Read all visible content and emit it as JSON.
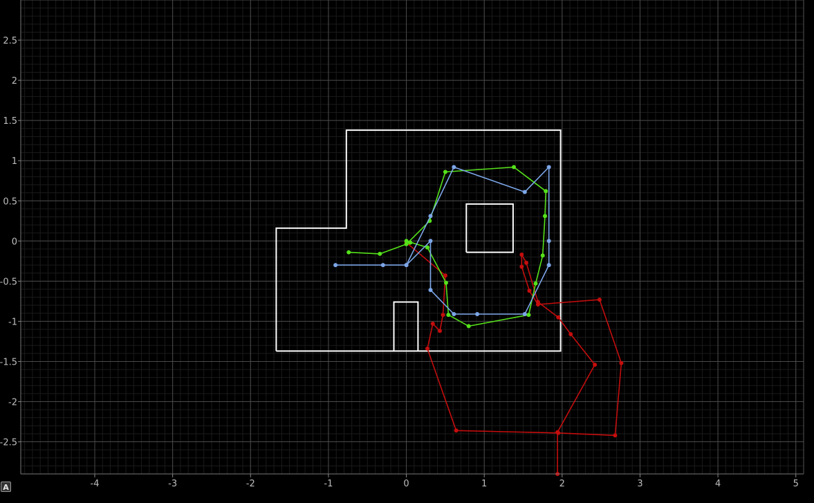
{
  "ui": {
    "autoscale_label": "A"
  },
  "chart_data": {
    "type": "line",
    "xlim": [
      -4.95,
      5.1
    ],
    "ylim": [
      -2.9,
      3.0
    ],
    "x_ticks": [
      -4,
      -3,
      -2,
      -1,
      0,
      1,
      2,
      3,
      4,
      5
    ],
    "y_ticks": [
      -2.5,
      -2,
      -1.5,
      -1,
      -0.5,
      0,
      0.5,
      1,
      1.5,
      2,
      2.5
    ],
    "grid": true,
    "minor_grid_step": 0.1,
    "colors": {
      "background": "#000000",
      "major_grid": "#4a4a4a",
      "minor_grid": "#1b1b1b",
      "walls": "#ffffff",
      "red": "#c40d0d",
      "green": "#55e21a",
      "blue": "#7ca6e8",
      "tick_text": "#bdbdbd"
    },
    "shapes": [
      {
        "points": [
          [
            -1.67,
            -1.37
          ],
          [
            1.98,
            -1.37
          ],
          [
            1.98,
            1.38
          ],
          [
            -0.77,
            1.38
          ],
          [
            -0.77,
            0.16
          ],
          [
            -1.67,
            0.16
          ],
          [
            -1.67,
            -1.37
          ]
        ]
      },
      {
        "points": [
          [
            0.77,
            -0.14
          ],
          [
            1.37,
            -0.14
          ],
          [
            1.37,
            0.46
          ],
          [
            0.77,
            0.46
          ],
          [
            0.77,
            -0.14
          ]
        ]
      },
      {
        "points": [
          [
            -0.16,
            -1.37
          ],
          [
            -0.16,
            -0.76
          ],
          [
            0.15,
            -0.76
          ],
          [
            0.15,
            -1.37
          ]
        ]
      }
    ],
    "series": [
      {
        "color": "red",
        "points": [
          [
            0.0,
            -0.02
          ],
          [
            0.5,
            -0.43
          ],
          [
            0.47,
            -0.92
          ],
          [
            0.43,
            -1.12
          ],
          [
            0.34,
            -1.03
          ],
          [
            0.27,
            -1.34
          ],
          [
            0.64,
            -2.36
          ],
          [
            1.95,
            -2.39
          ],
          [
            2.68,
            -2.42
          ],
          [
            2.76,
            -1.52
          ],
          [
            2.48,
            -0.73
          ],
          [
            1.69,
            -0.79
          ],
          [
            1.58,
            -0.62
          ],
          [
            1.48,
            -0.32
          ],
          [
            1.48,
            -0.17
          ],
          [
            1.54,
            -0.27
          ],
          [
            1.69,
            -0.76
          ],
          [
            1.95,
            -0.95
          ],
          [
            2.11,
            -1.16
          ],
          [
            2.42,
            -1.54
          ],
          [
            1.94,
            -2.38
          ],
          [
            1.94,
            -2.9
          ]
        ]
      },
      {
        "color": "green",
        "points": [
          [
            -0.74,
            -0.14
          ],
          [
            -0.34,
            -0.16
          ],
          [
            0.0,
            -0.04
          ],
          [
            0.3,
            0.25
          ],
          [
            0.5,
            0.86
          ],
          [
            1.38,
            0.92
          ],
          [
            1.79,
            0.62
          ],
          [
            1.78,
            0.31
          ],
          [
            1.75,
            -0.18
          ],
          [
            1.66,
            -0.53
          ],
          [
            1.57,
            -0.92
          ],
          [
            0.8,
            -1.06
          ],
          [
            0.54,
            -0.92
          ],
          [
            0.51,
            -0.52
          ],
          [
            0.27,
            -0.08
          ],
          [
            0.0,
            0.0
          ],
          [
            0.05,
            -0.02
          ]
        ]
      },
      {
        "color": "blue",
        "points": [
          [
            -0.91,
            -0.3
          ],
          [
            -0.3,
            -0.3
          ],
          [
            0.0,
            -0.3
          ],
          [
            0.31,
            0.31
          ],
          [
            0.61,
            0.92
          ],
          [
            1.52,
            0.61
          ],
          [
            1.83,
            0.92
          ],
          [
            1.83,
            0.0
          ],
          [
            1.83,
            -0.3
          ],
          [
            1.52,
            -0.91
          ],
          [
            0.91,
            -0.91
          ],
          [
            0.61,
            -0.91
          ],
          [
            0.31,
            -0.61
          ],
          [
            0.31,
            0.0
          ],
          [
            0.0,
            -0.3
          ]
        ]
      }
    ]
  }
}
